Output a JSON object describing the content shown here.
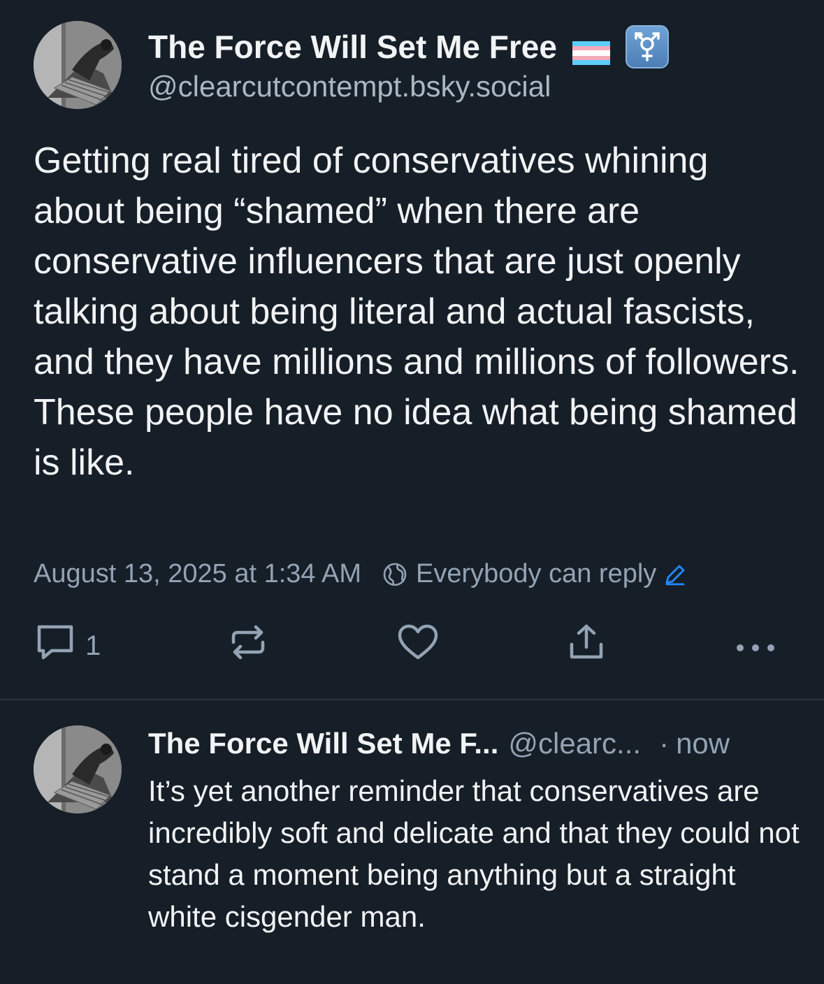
{
  "post": {
    "author": {
      "display_name": "The Force Will Set Me Free",
      "handle": "@clearcutcontempt.bsky.social",
      "badges": [
        "transgender-flag-icon",
        "transgender-symbol-icon"
      ]
    },
    "text": "Getting real tired of conservatives whining about being “shamed” when there are conservative influencers that are just openly talking about being literal and actual fascists, and they have millions and millions of followers. These people have no idea what being shamed is like.",
    "timestamp": "August 13, 2025 at 1:34 AM",
    "reply_setting": "Everybody can reply",
    "actions": {
      "reply_count": "1",
      "icons": [
        "reply-icon",
        "repost-icon",
        "like-icon",
        "share-icon",
        "more-icon"
      ]
    }
  },
  "reply": {
    "author_name": "The Force Will Set Me F...",
    "author_handle": "@clearc...",
    "separator": "·",
    "time": "now",
    "text": "It’s yet another reminder that conservatives are incredibly soft and delicate and that they could not stand a moment being anything but a straight white cisgender man."
  },
  "colors": {
    "background": "#161e27",
    "text_primary": "#f1f3f5",
    "text_secondary": "#93a3b4",
    "accent": "#208bfe",
    "divider": "#2b3643"
  }
}
